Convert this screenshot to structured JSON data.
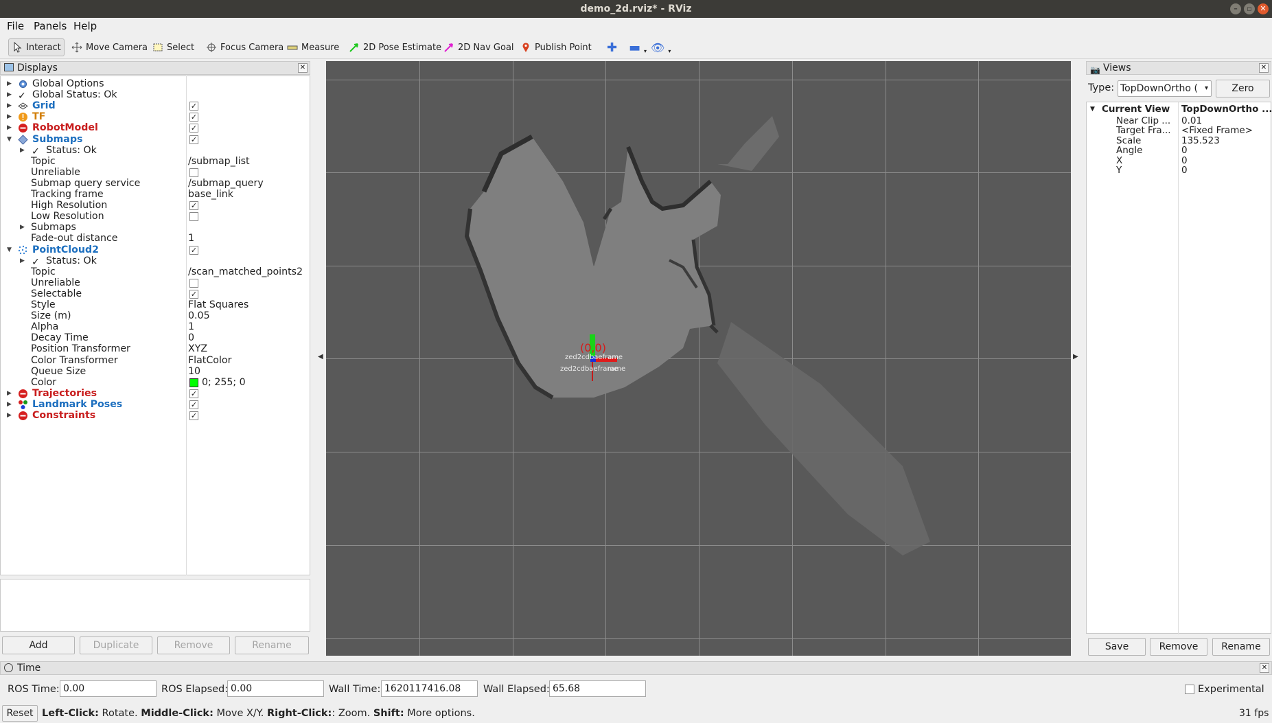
{
  "window": {
    "title": "demo_2d.rviz* - RViz"
  },
  "menu": {
    "file": "File",
    "panels": "Panels",
    "help": "Help"
  },
  "toolbar": {
    "interact": "Interact",
    "move_camera": "Move Camera",
    "select": "Select",
    "focus_camera": "Focus Camera",
    "measure": "Measure",
    "pose_estimate": "2D Pose Estimate",
    "nav_goal": "2D Nav Goal",
    "publish_point": "Publish Point"
  },
  "displays": {
    "title": "Displays",
    "rows": [
      {
        "label": "Global Options",
        "value": ""
      },
      {
        "label": "Global Status: Ok",
        "value": ""
      },
      {
        "label": "Grid",
        "value": ""
      },
      {
        "label": "TF",
        "value": ""
      },
      {
        "label": "RobotModel",
        "value": ""
      },
      {
        "label": "Submaps",
        "value": ""
      },
      {
        "label": "Status: Ok",
        "value": ""
      },
      {
        "label": "Topic",
        "value": "/submap_list"
      },
      {
        "label": "Unreliable",
        "value": ""
      },
      {
        "label": "Submap query service",
        "value": "/submap_query"
      },
      {
        "label": "Tracking frame",
        "value": "base_link"
      },
      {
        "label": "High Resolution",
        "value": ""
      },
      {
        "label": "Low Resolution",
        "value": ""
      },
      {
        "label": "Submaps",
        "value": ""
      },
      {
        "label": "Fade-out distance",
        "value": "1"
      },
      {
        "label": "PointCloud2",
        "value": ""
      },
      {
        "label": "Status: Ok",
        "value": ""
      },
      {
        "label": "Topic",
        "value": "/scan_matched_points2"
      },
      {
        "label": "Unreliable",
        "value": ""
      },
      {
        "label": "Selectable",
        "value": ""
      },
      {
        "label": "Style",
        "value": "Flat Squares"
      },
      {
        "label": "Size (m)",
        "value": "0.05"
      },
      {
        "label": "Alpha",
        "value": "1"
      },
      {
        "label": "Decay Time",
        "value": "0"
      },
      {
        "label": "Position Transformer",
        "value": "XYZ"
      },
      {
        "label": "Color Transformer",
        "value": "FlatColor"
      },
      {
        "label": "Queue Size",
        "value": "10"
      },
      {
        "label": "Color",
        "value": "0; 255; 0"
      },
      {
        "label": "Trajectories",
        "value": ""
      },
      {
        "label": "Landmark Poses",
        "value": ""
      },
      {
        "label": "Constraints",
        "value": ""
      }
    ],
    "buttons": {
      "add": "Add",
      "duplicate": "Duplicate",
      "remove": "Remove",
      "rename": "Rename"
    }
  },
  "viewport": {
    "origin_label": "(0,0)",
    "frame_label_1": "zed2cdbaefram",
    "frame_label_2": "zed2cdbaeframe"
  },
  "views": {
    "title": "Views",
    "type_label": "Type:",
    "type_value": "TopDownOrtho (",
    "zero": "Zero",
    "current_view": "Current View",
    "current_view_value": "TopDownOrtho ...",
    "props": [
      {
        "k": "Near Clip ...",
        "v": "0.01"
      },
      {
        "k": "Target Fra...",
        "v": "<Fixed Frame>"
      },
      {
        "k": "Scale",
        "v": "135.523"
      },
      {
        "k": "Angle",
        "v": "0"
      },
      {
        "k": "X",
        "v": "0"
      },
      {
        "k": "Y",
        "v": "0"
      }
    ],
    "buttons": {
      "save": "Save",
      "remove": "Remove",
      "rename": "Rename"
    }
  },
  "time": {
    "title": "Time",
    "ros_time_label": "ROS Time:",
    "ros_time": "0.00",
    "ros_elapsed_label": "ROS Elapsed:",
    "ros_elapsed": "0.00",
    "wall_time_label": "Wall Time:",
    "wall_time": "1620117416.08",
    "wall_elapsed_label": "Wall Elapsed:",
    "wall_elapsed": "65.68",
    "experimental": "Experimental"
  },
  "status": {
    "reset": "Reset",
    "left_click_key": "Left-Click:",
    "left_click_text": " Rotate. ",
    "middle_click_key": "Middle-Click:",
    "middle_click_text": " Move X/Y. ",
    "right_click_key": "Right-Click:",
    "right_click_text": ": Zoom. ",
    "shift_key": "Shift:",
    "shift_text": " More options.",
    "fps": "31 fps"
  },
  "colors": {
    "point_color": "#00ff00",
    "grid": "#8c8c8c",
    "map_free": "#7c7c7c",
    "map_wall": "#2e2e2e"
  }
}
